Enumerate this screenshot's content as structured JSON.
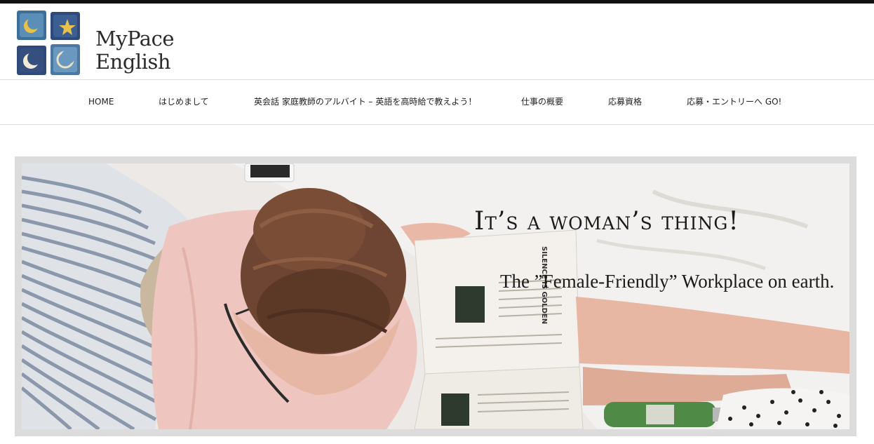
{
  "header": {
    "logo": {
      "line1": "MyPace",
      "line2": "English"
    }
  },
  "nav": {
    "items": [
      {
        "label": "HOME"
      },
      {
        "label": "はじめまして"
      },
      {
        "label": "英会話 家庭教師のアルバイト – 英語を高時給で教えよう！"
      },
      {
        "label": "仕事の概要"
      },
      {
        "label": "応募資格"
      },
      {
        "label": "応募・エントリーへ GO!"
      }
    ]
  },
  "hero": {
    "title": "It’s a woman’s thing!",
    "subtitle": "The ”Female-Friendly” Workplace on earth.",
    "magazine_text": "SILENCE IS GOLDEN"
  },
  "colors": {
    "top_bar": "#111111",
    "logo_tile_blue": "#3d6f98",
    "logo_tile_navy": "#2f4a7a",
    "logo_icon_gold": "#e8c24a",
    "hero_frame": "#dcdcdc"
  },
  "icons": {
    "logo_tiles": [
      "moon-icon",
      "star-icon",
      "crescent-icon",
      "moon-outline-icon"
    ]
  }
}
